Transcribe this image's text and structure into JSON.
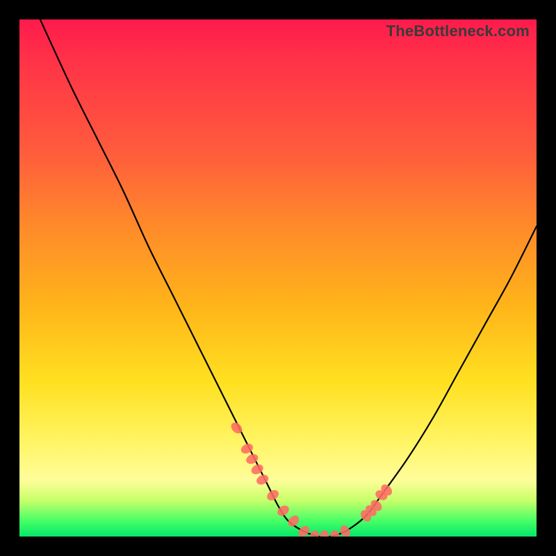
{
  "watermark": "TheBottleneck.com",
  "chart_data": {
    "type": "line",
    "title": "",
    "xlabel": "",
    "ylabel": "",
    "xlim": [
      0,
      100
    ],
    "ylim": [
      0,
      100
    ],
    "series": [
      {
        "name": "bottleneck-curve",
        "x": [
          4,
          10,
          15,
          20,
          25,
          30,
          35,
          40,
          45,
          48,
          50,
          52,
          55,
          58,
          60,
          63,
          67,
          70,
          75,
          80,
          85,
          90,
          95,
          100
        ],
        "values": [
          100,
          87,
          77,
          67,
          56,
          46,
          36,
          26,
          16,
          10,
          6,
          3,
          1,
          0,
          0,
          1,
          4,
          8,
          15,
          23,
          32,
          41,
          50,
          60
        ]
      }
    ],
    "markers": {
      "name": "hotspots",
      "color": "#ff6b63",
      "x": [
        42,
        44,
        45,
        46,
        47,
        49,
        51,
        53,
        55,
        57,
        59,
        61,
        63,
        67,
        68,
        69,
        70,
        71
      ],
      "values": [
        21,
        17,
        15,
        13,
        11,
        8,
        5,
        3,
        1,
        0,
        0,
        0,
        1,
        4,
        5,
        6,
        8,
        9
      ]
    },
    "gradient_stops": [
      {
        "pos": 0,
        "color": "#ff1a4d"
      },
      {
        "pos": 25,
        "color": "#ff5a3d"
      },
      {
        "pos": 55,
        "color": "#ffb31a"
      },
      {
        "pos": 82,
        "color": "#fff566"
      },
      {
        "pos": 97,
        "color": "#46ff66"
      },
      {
        "pos": 100,
        "color": "#05e669"
      }
    ]
  }
}
